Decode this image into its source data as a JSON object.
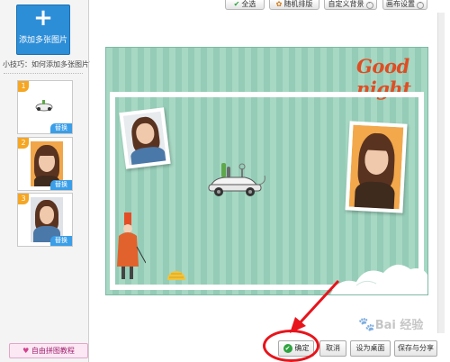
{
  "left_panel": {
    "add_multi_label": "添加多张图片",
    "tip": "小技巧：如何添加多张图片?",
    "thumbnails": [
      {
        "index": "1",
        "swap_label": "替换"
      },
      {
        "index": "2",
        "swap_label": "替换"
      },
      {
        "index": "3",
        "swap_label": "替换"
      }
    ],
    "tutorial_label": "自由拼图教程"
  },
  "toolbar": {
    "select_all": "全选",
    "random_layout": "随机排版",
    "custom_background": "自定义背景",
    "canvas_settings": "画布设置"
  },
  "canvas": {
    "title_text": "Good night",
    "background_color": "#9ed3bf",
    "frame_color": "#ffffff",
    "title_color": "#e04d23"
  },
  "bottom_bar": {
    "ok_label": "确定",
    "cancel_label": "取消",
    "wallpaper_label": "设为桌面",
    "save_share_label": "保存与分享"
  },
  "watermark": {
    "text": "Bai 经验"
  },
  "colors": {
    "highlight": "#e8141b",
    "accent_blue": "#2d8ed8"
  }
}
